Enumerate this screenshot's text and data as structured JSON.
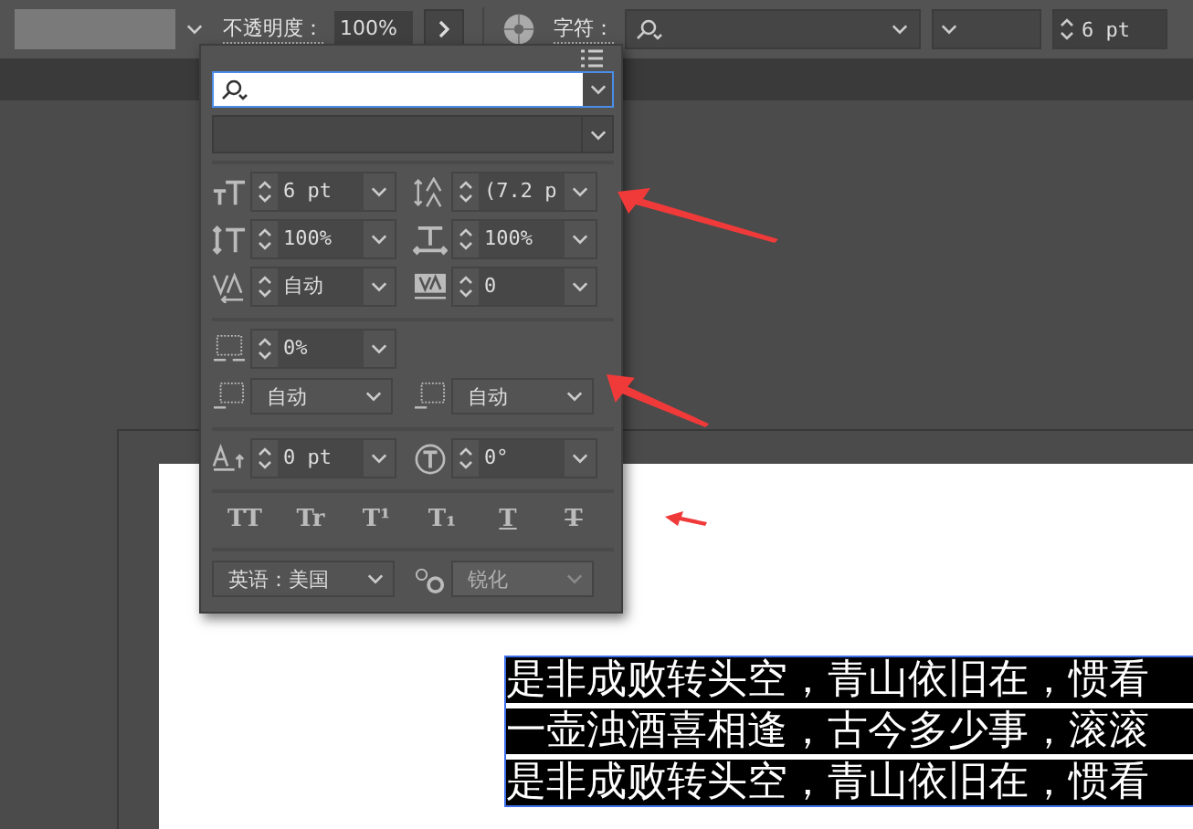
{
  "toolbar": {
    "opacity_label": "不透明度：",
    "opacity_value": "100%",
    "character_label": "字符：",
    "font_size": "6 pt"
  },
  "panel": {
    "fields": [
      {
        "kind": "spin",
        "value": "6 pt"
      },
      {
        "kind": "spin",
        "value": "(7.2 p"
      },
      {
        "kind": "spin",
        "value": "100%"
      },
      {
        "kind": "spin",
        "value": "100%"
      },
      {
        "kind": "spin",
        "value": "自动"
      },
      {
        "kind": "spin",
        "value": "0"
      },
      {
        "kind": "spin",
        "value": "0%"
      },
      {
        "kind": "select",
        "value": "自动"
      },
      {
        "kind": "select",
        "value": "自动"
      },
      {
        "kind": "spin",
        "value": "0 pt"
      },
      {
        "kind": "spin",
        "value": "0°"
      }
    ],
    "styles": [
      {
        "label": "TT",
        "kind": "plain"
      },
      {
        "label": "Tr",
        "kind": "plain"
      },
      {
        "label": "T¹",
        "kind": "plain"
      },
      {
        "label": "T₁",
        "kind": "plain"
      },
      {
        "label": "T",
        "kind": "underline"
      },
      {
        "label": "T",
        "kind": "strike"
      }
    ],
    "language": "英语：美国",
    "antialias": {
      "value": "锐化",
      "disabled": true
    }
  },
  "document": {
    "lines": [
      "是非成败转头空，青山依旧在，惯看",
      "一壶浊酒喜相逢，古今多少事，滚滚",
      "是非成败转头空，青山依旧在，惯看"
    ]
  }
}
